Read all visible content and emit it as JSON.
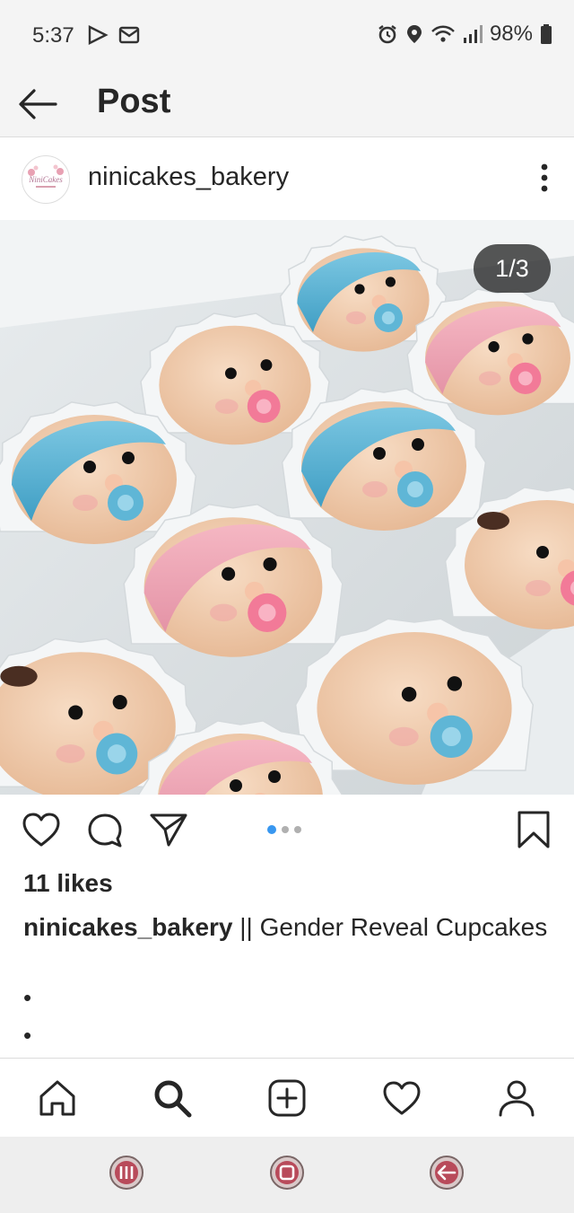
{
  "status_bar": {
    "time": "5:37",
    "battery": "98%",
    "icons": [
      "play-store-icon",
      "mail-icon",
      "alarm-icon",
      "location-icon",
      "wifi-icon",
      "signal-icon",
      "battery-icon"
    ]
  },
  "header": {
    "title": "Post",
    "back_icon": "back-arrow-icon"
  },
  "post": {
    "username": "ninicakes_bakery",
    "avatar_label": "NiniCakes",
    "counter": "1/3",
    "carousel": {
      "total": 3,
      "current": 1
    },
    "likes": "11 likes",
    "caption_user": "ninicakes_bakery",
    "caption_text": " || Gender Reveal Cupcakes",
    "bullets": [
      "•",
      "•"
    ]
  },
  "colors": {
    "accent_blue": "#3897f0",
    "text": "#262626",
    "cupcake_blue": "#5fb6d6",
    "cupcake_pink": "#f1a3b3",
    "skin": "#f1c9a6"
  },
  "bottom_nav": [
    "home-icon",
    "search-icon",
    "add-post-icon",
    "activity-heart-icon",
    "profile-icon"
  ],
  "system_nav": [
    "recent-apps-icon",
    "home-button-icon",
    "back-button-icon"
  ]
}
